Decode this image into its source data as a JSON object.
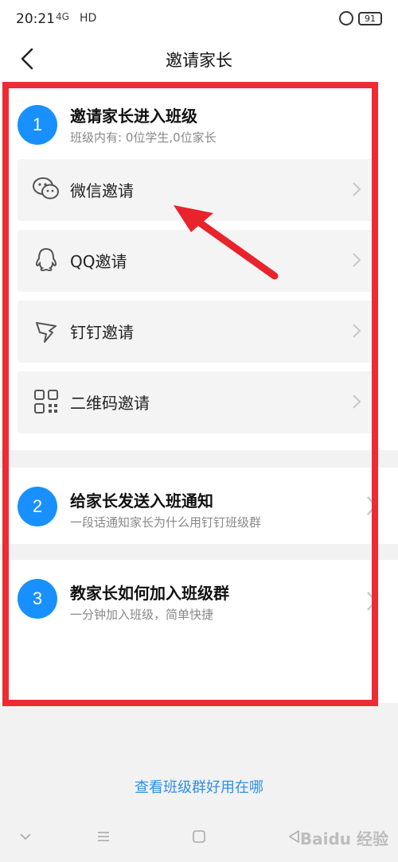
{
  "status": {
    "time": "20:21",
    "signal": "4G",
    "hd": "HD",
    "battery": "91"
  },
  "header": {
    "title": "邀请家长"
  },
  "steps": [
    {
      "number": "1",
      "title": "邀请家长进入班级",
      "subtitle": "班级内有: 0位学生,0位家长"
    },
    {
      "number": "2",
      "title": "给家长发送入班通知",
      "subtitle": "一段话通知家长为什么用钉钉班级群"
    },
    {
      "number": "3",
      "title": "教家长如何加入班级群",
      "subtitle": "一分钟加入班级，简单快捷"
    }
  ],
  "options": [
    {
      "label": "微信邀请",
      "icon": "wechat-icon"
    },
    {
      "label": "QQ邀请",
      "icon": "qq-icon"
    },
    {
      "label": "钉钉邀请",
      "icon": "dingtalk-icon"
    },
    {
      "label": "二维码邀请",
      "icon": "qrcode-icon"
    }
  ],
  "footer": {
    "link": "查看班级群好用在哪"
  },
  "watermark": "Baidu 经验",
  "colors": {
    "accent": "#1890ff",
    "highlight": "#ee2b33",
    "link": "#2d8fe6"
  }
}
